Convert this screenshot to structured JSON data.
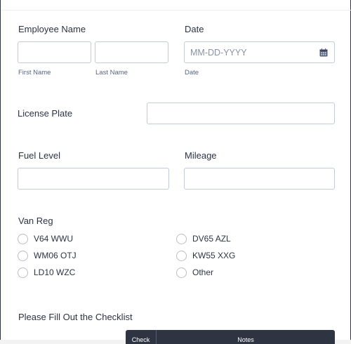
{
  "employee": {
    "label": "Employee Name",
    "first_label": "First Name",
    "last_label": "Last Name",
    "first_value": "",
    "last_value": ""
  },
  "date": {
    "label": "Date",
    "placeholder": "MM-DD-YYYY",
    "sublabel": "Date",
    "icon": "calendar-icon"
  },
  "license": {
    "label": "License Plate",
    "value": ""
  },
  "fuel": {
    "label": "Fuel Level",
    "value": ""
  },
  "mileage": {
    "label": "Mileage",
    "value": ""
  },
  "van_reg": {
    "label": "Van Reg",
    "options": [
      "V64 WWU",
      "WM06 OTJ",
      "LD10 WZC",
      "DV65 AZL",
      "KW55 XXG",
      "Other"
    ]
  },
  "checklist": {
    "label": "Please Fill Out the Checklist",
    "columns": [
      "Check",
      "Notes"
    ]
  },
  "colors": {
    "accent_dark": "#2e3442",
    "input_border": "#c3cad8",
    "text": "#2c3345"
  }
}
